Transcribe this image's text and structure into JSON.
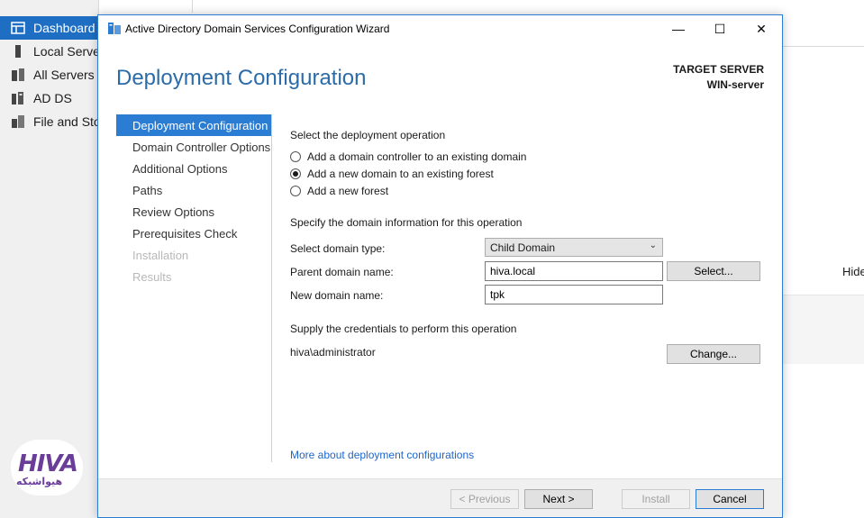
{
  "background": {
    "nav": [
      {
        "label": "Dashboard",
        "icon": "dashboard-icon",
        "active": true
      },
      {
        "label": "Local Server",
        "icon": "server-icon",
        "active": false
      },
      {
        "label": "All Servers",
        "icon": "servers-icon",
        "active": false
      },
      {
        "label": "AD DS",
        "icon": "ad-ds-icon",
        "active": false
      },
      {
        "label": "File and Storage Services",
        "icon": "storage-icon",
        "active": false
      }
    ],
    "hide_label": "Hide",
    "watermark": {
      "word": "HIVA",
      "subtitle": "هیواشبکه"
    }
  },
  "wizard": {
    "title": "Active Directory Domain Services Configuration Wizard",
    "heading": "Deployment Configuration",
    "target_label": "TARGET SERVER",
    "target_value": "WIN-server",
    "window_controls": {
      "minimize": "—",
      "maximize": "☐",
      "close": "✕"
    },
    "steps": [
      {
        "label": "Deployment Configuration",
        "state": "active"
      },
      {
        "label": "Domain Controller Options",
        "state": "normal"
      },
      {
        "label": "Additional Options",
        "state": "normal"
      },
      {
        "label": "Paths",
        "state": "normal"
      },
      {
        "label": "Review Options",
        "state": "normal"
      },
      {
        "label": "Prerequisites Check",
        "state": "normal"
      },
      {
        "label": "Installation",
        "state": "disabled"
      },
      {
        "label": "Results",
        "state": "disabled"
      }
    ],
    "operation": {
      "label": "Select the deployment operation",
      "options": [
        {
          "label": "Add a domain controller to an existing domain",
          "checked": false
        },
        {
          "label": "Add a new domain to an existing forest",
          "checked": true
        },
        {
          "label": "Add a new forest",
          "checked": false
        }
      ]
    },
    "domain_info": {
      "label": "Specify the domain information for this operation",
      "domain_type_label": "Select domain type:",
      "domain_type_value": "Child Domain",
      "parent_label": "Parent domain name:",
      "parent_value": "hiva.local",
      "select_button": "Select...",
      "new_label": "New domain name:",
      "new_value": "tpk"
    },
    "credentials": {
      "label": "Supply the credentials to perform this operation",
      "user": "hiva\\administrator",
      "change_button": "Change..."
    },
    "more_link": "More about deployment configurations",
    "footer": {
      "previous": "< Previous",
      "next": "Next >",
      "install": "Install",
      "cancel": "Cancel"
    }
  }
}
